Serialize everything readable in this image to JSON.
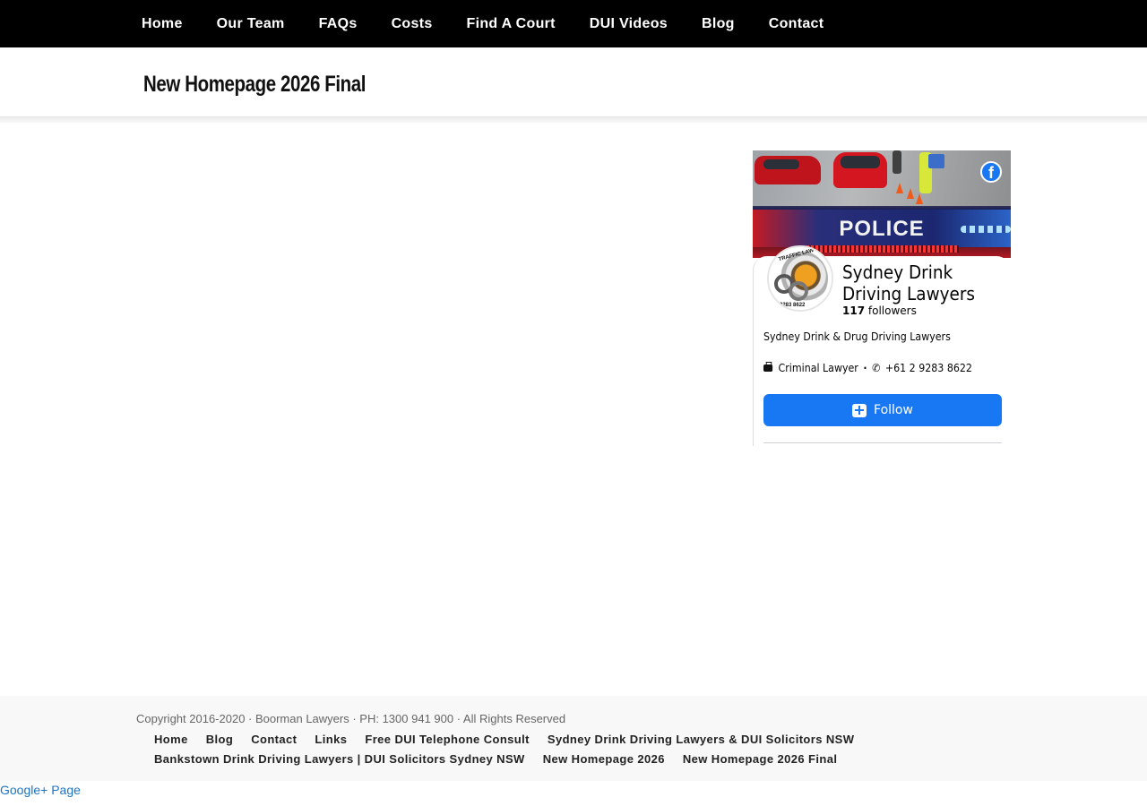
{
  "nav": {
    "items": [
      "Home",
      "Our Team",
      "FAQs",
      "Costs",
      "Find A Court",
      "DUI Videos",
      "Blog",
      "Contact"
    ]
  },
  "header": {
    "title": "New Homepage 2026 Final"
  },
  "facebook_widget": {
    "cover_text": "POLICE",
    "logo_glyph": "f",
    "avatar_text": "TRAFFIC LAWYERS",
    "avatar_phone": "9283 8622",
    "page_name": "Sydney Drink Driving Lawyers",
    "followers_count": "117",
    "followers_label": "followers",
    "description": "Sydney Drink & Drug Driving Lawyers",
    "category": "Criminal Lawyer",
    "separator": "·",
    "phone": "+61 2 9283 8622",
    "follow_label": "Follow",
    "brand_color": "#1877f2"
  },
  "footer": {
    "copyright": "Copyright 2016-2020 · Boorman Lawyers · PH: 1300 941 900 · All Rights Reserved",
    "links": [
      "Home",
      "Blog",
      "Contact",
      "Links",
      "Free DUI Telephone Consult",
      "Sydney Drink Driving Lawyers & DUI Solicitors NSW",
      "Bankstown Drink Driving Lawyers | DUI Solicitors Sydney NSW",
      "New Homepage 2026",
      "New Homepage 2026 Final"
    ]
  },
  "google_plus": "Google+ Page"
}
